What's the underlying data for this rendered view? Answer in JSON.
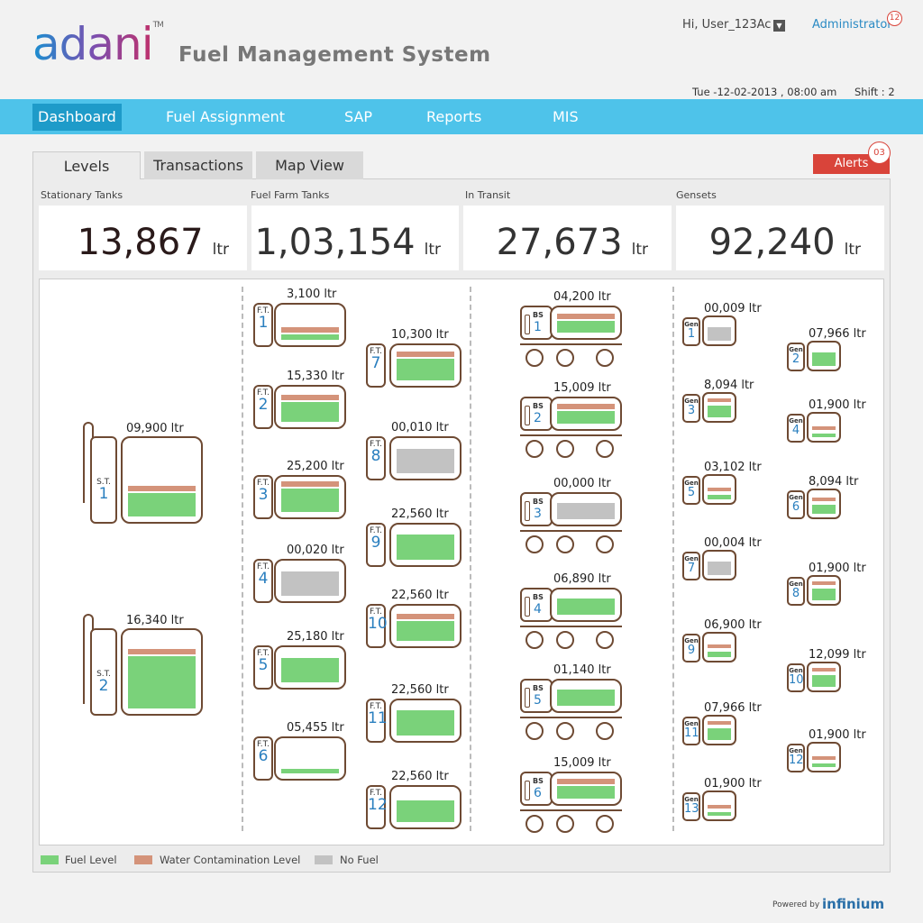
{
  "header": {
    "logo_text": "adani",
    "logo_tm": "TM",
    "app_title": "Fuel Management System",
    "user_greeting": "Hi, User_123Ac",
    "admin_label": "Administrator",
    "admin_badge": "12",
    "datetime": "Tue -12-02-2013 ,  08:00 am",
    "shift": "Shift : 2"
  },
  "nav": {
    "items": [
      {
        "label": "Dashboard",
        "active": true
      },
      {
        "label": "Fuel  Assignment",
        "active": false
      },
      {
        "label": "SAP",
        "active": false
      },
      {
        "label": "Reports",
        "active": false
      },
      {
        "label": "MIS",
        "active": false
      }
    ]
  },
  "tabs": [
    {
      "label": "Levels",
      "active": true
    },
    {
      "label": "Transactions",
      "active": false
    },
    {
      "label": "Map View",
      "active": false
    }
  ],
  "alerts": {
    "label": "Alerts",
    "count": "03"
  },
  "summary": [
    {
      "label": "Stationary Tanks",
      "value": "13,867",
      "unit": "ltr"
    },
    {
      "label": "Fuel Farm Tanks",
      "value": "1,03,154",
      "unit": "ltr"
    },
    {
      "label": "In Transit",
      "value": "27,673",
      "unit": "ltr"
    },
    {
      "label": "Gensets",
      "value": "92,240",
      "unit": "ltr"
    }
  ],
  "stationary_tanks": [
    {
      "abbr": "S.T.",
      "num": "1",
      "label": "09,900 ltr",
      "fuel_pct": 32,
      "water": true,
      "status": "fuel"
    },
    {
      "abbr": "S.T.",
      "num": "2",
      "label": "16,340 ltr",
      "fuel_pct": 72,
      "water": true,
      "status": "fuel"
    }
  ],
  "fuel_farm_tanks": [
    {
      "abbr": "F.T.",
      "num": "1",
      "label": "3,100 ltr",
      "fuel_pct": 18,
      "water": true,
      "status": "fuel"
    },
    {
      "abbr": "F.T.",
      "num": "2",
      "label": "15,330 ltr",
      "fuel_pct": 66,
      "water": true,
      "status": "fuel"
    },
    {
      "abbr": "F.T.",
      "num": "3",
      "label": "25,200 ltr",
      "fuel_pct": 80,
      "water": true,
      "status": "fuel"
    },
    {
      "abbr": "F.T.",
      "num": "4",
      "label": "00,020 ltr",
      "fuel_pct": 82,
      "water": false,
      "status": "none"
    },
    {
      "abbr": "F.T.",
      "num": "5",
      "label": "25,180 ltr",
      "fuel_pct": 82,
      "water": false,
      "status": "fuel"
    },
    {
      "abbr": "F.T.",
      "num": "6",
      "label": "05,455 ltr",
      "fuel_pct": 14,
      "water": false,
      "status": "fuel"
    },
    {
      "abbr": "F.T.",
      "num": "7",
      "label": "10,300 ltr",
      "fuel_pct": 72,
      "water": true,
      "status": "fuel"
    },
    {
      "abbr": "F.T.",
      "num": "8",
      "label": "00,010 ltr",
      "fuel_pct": 82,
      "water": false,
      "status": "none"
    },
    {
      "abbr": "F.T.",
      "num": "9",
      "label": "22,560 ltr",
      "fuel_pct": 84,
      "water": false,
      "status": "fuel"
    },
    {
      "abbr": "F.T.",
      "num": "10",
      "label": "22,560 ltr",
      "fuel_pct": 66,
      "water": true,
      "status": "fuel"
    },
    {
      "abbr": "F.T.",
      "num": "11",
      "label": "22,560 ltr",
      "fuel_pct": 84,
      "water": false,
      "status": "fuel"
    },
    {
      "abbr": "F.T.",
      "num": "12",
      "label": "22,560 ltr",
      "fuel_pct": 72,
      "water": false,
      "status": "fuel"
    }
  ],
  "bowsers": [
    {
      "abbr": "BS",
      "num": "1",
      "label": "04,200 ltr",
      "fuel_pct": 60,
      "water": true,
      "status": "fuel"
    },
    {
      "abbr": "BS",
      "num": "2",
      "label": "15,009 ltr",
      "fuel_pct": 62,
      "water": true,
      "status": "fuel"
    },
    {
      "abbr": "BS",
      "num": "3",
      "label": "00,000 ltr",
      "fuel_pct": 82,
      "water": false,
      "status": "none"
    },
    {
      "abbr": "BS",
      "num": "4",
      "label": "06,890 ltr",
      "fuel_pct": 82,
      "water": false,
      "status": "fuel"
    },
    {
      "abbr": "BS",
      "num": "5",
      "label": "01,140 ltr",
      "fuel_pct": 82,
      "water": false,
      "status": "fuel"
    },
    {
      "abbr": "BS",
      "num": "6",
      "label": "15,009 ltr",
      "fuel_pct": 62,
      "water": true,
      "status": "fuel"
    }
  ],
  "gensets": [
    {
      "abbr": "Gen",
      "num": "1",
      "label": "00,009 ltr",
      "fuel_pct": 82,
      "water": false,
      "status": "none"
    },
    {
      "abbr": "Gen",
      "num": "2",
      "label": "07,966 ltr",
      "fuel_pct": 82,
      "water": false,
      "status": "fuel"
    },
    {
      "abbr": "Gen",
      "num": "3",
      "label": "8,094 ltr",
      "fuel_pct": 72,
      "water": true,
      "status": "fuel"
    },
    {
      "abbr": "Gen",
      "num": "4",
      "label": "01,900 ltr",
      "fuel_pct": 22,
      "water": true,
      "status": "fuel"
    },
    {
      "abbr": "Gen",
      "num": "5",
      "label": "03,102 ltr",
      "fuel_pct": 30,
      "water": true,
      "status": "fuel"
    },
    {
      "abbr": "Gen",
      "num": "6",
      "label": "8,094 ltr",
      "fuel_pct": 55,
      "water": true,
      "status": "fuel"
    },
    {
      "abbr": "Gen",
      "num": "7",
      "label": "00,004 ltr",
      "fuel_pct": 82,
      "water": false,
      "status": "none"
    },
    {
      "abbr": "Gen",
      "num": "8",
      "label": "01,900 ltr",
      "fuel_pct": 72,
      "water": true,
      "status": "fuel"
    },
    {
      "abbr": "Gen",
      "num": "9",
      "label": "06,900 ltr",
      "fuel_pct": 35,
      "water": true,
      "status": "fuel"
    },
    {
      "abbr": "Gen",
      "num": "10",
      "label": "12,099 ltr",
      "fuel_pct": 72,
      "water": true,
      "status": "fuel"
    },
    {
      "abbr": "Gen",
      "num": "11",
      "label": "07,966 ltr",
      "fuel_pct": 72,
      "water": true,
      "status": "fuel"
    },
    {
      "abbr": "Gen",
      "num": "12",
      "label": "01,900 ltr",
      "fuel_pct": 22,
      "water": true,
      "status": "fuel"
    },
    {
      "abbr": "Gen",
      "num": "13",
      "label": "01,900 ltr",
      "fuel_pct": 22,
      "water": true,
      "status": "fuel"
    }
  ],
  "legend": [
    {
      "label": "Fuel Level",
      "color": "#7ad27a"
    },
    {
      "label": "Water Contamination Level",
      "color": "#d4937a"
    },
    {
      "label": "No Fuel",
      "color": "#c2c2c2"
    }
  ],
  "footer": {
    "powered_by": "Powered by",
    "brand": "infinium"
  },
  "colors": {
    "nav": "#4ec3ea",
    "nav_active": "#1e9bc9",
    "alert": "#d9443a",
    "fuel": "#7ad27a",
    "water": "#d4937a",
    "no_fuel": "#c2c2c2",
    "outline": "#6e4a33",
    "id_text": "#2a7fbf"
  }
}
